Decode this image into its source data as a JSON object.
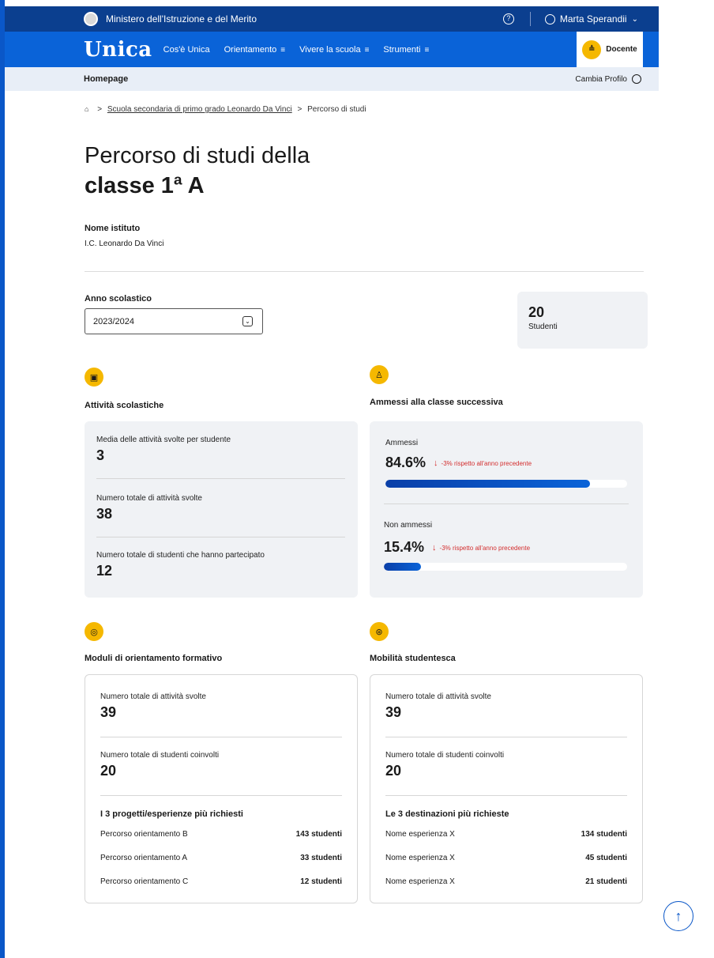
{
  "topbar": {
    "ministry": "Ministero dell'Istruzione e del Merito",
    "help_icon": "?",
    "user_name": "Marta Sperandii",
    "chevron": "⌄"
  },
  "nav": {
    "logo": "Unica",
    "items": [
      {
        "label": "Cos'è Unica",
        "burger": ""
      },
      {
        "label": "Orientamento",
        "burger": "≡"
      },
      {
        "label": "Vivere la scuola",
        "burger": "≡"
      },
      {
        "label": "Strumenti",
        "burger": "≡"
      }
    ],
    "profile_label": "Docente",
    "profile_badge": "≙"
  },
  "subbar": {
    "home": "Homepage",
    "cambia": "Cambia Profilo"
  },
  "breadcrumb": {
    "home_icon": "⌂",
    "sep": ">",
    "school": "Scuola secondaria di primo grado Leonardo Da Vinci",
    "current": "Percorso di studi"
  },
  "title": {
    "line1": "Percorso di studi della",
    "line2": "classe 1ª A"
  },
  "istituto": {
    "label": "Nome istituto",
    "value": "I.C. Leonardo Da Vinci"
  },
  "anno": {
    "label": "Anno scolastico",
    "value": "2023/2024",
    "caret": "⌄"
  },
  "studenti": {
    "num": "20",
    "label": "Studenti"
  },
  "attivita": {
    "icon": "▣",
    "title": "Attività scolastiche",
    "stats": [
      {
        "label": "Media delle attività svolte per studente",
        "value": "3"
      },
      {
        "label": "Numero totale di attività svolte",
        "value": "38"
      },
      {
        "label": "Numero totale di studenti che hanno partecipato",
        "value": "12"
      }
    ]
  },
  "ammessi": {
    "icon": "♙",
    "title": "Ammessi alla classe successiva",
    "items": [
      {
        "label": "Ammessi",
        "pct": "84.6%",
        "value": 84.6,
        "delta": "-3% rispetto all'anno precedente"
      },
      {
        "label": "Non ammessi",
        "pct": "15.4%",
        "value": 15.4,
        "delta": "-3% rispetto all'anno precedente"
      }
    ],
    "arrow": "↓"
  },
  "moduli": {
    "icon": "◎",
    "title": "Moduli di orientamento formativo",
    "stats": [
      {
        "label": "Numero totale di attività svolte",
        "value": "39"
      },
      {
        "label": "Numero totale di studenti coinvolti",
        "value": "20"
      }
    ],
    "list_title": "I 3 progetti/esperienze più richiesti",
    "rows": [
      {
        "name": "Percorso orientamento B",
        "count": "143 studenti"
      },
      {
        "name": "Percorso orientamento A",
        "count": "33 studenti"
      },
      {
        "name": "Percorso orientamento C",
        "count": "12 studenti"
      }
    ]
  },
  "mobilita": {
    "icon": "⊛",
    "title": "Mobilità studentesca",
    "stats": [
      {
        "label": "Numero totale di attività svolte",
        "value": "39"
      },
      {
        "label": "Numero totale di studenti coinvolti",
        "value": "20"
      }
    ],
    "list_title": "Le 3 destinazioni più richieste",
    "rows": [
      {
        "name": "Nome esperienza X",
        "count": "134 studenti"
      },
      {
        "name": "Nome esperienza X",
        "count": "45 studenti"
      },
      {
        "name": "Nome esperienza X",
        "count": "21 studenti"
      }
    ]
  },
  "totop": "↑",
  "colors": {
    "primary": "#0a63d8",
    "dark_blue": "#0b3f8f",
    "accent_yellow": "#f5b800",
    "delta_red": "#d32f2f"
  }
}
